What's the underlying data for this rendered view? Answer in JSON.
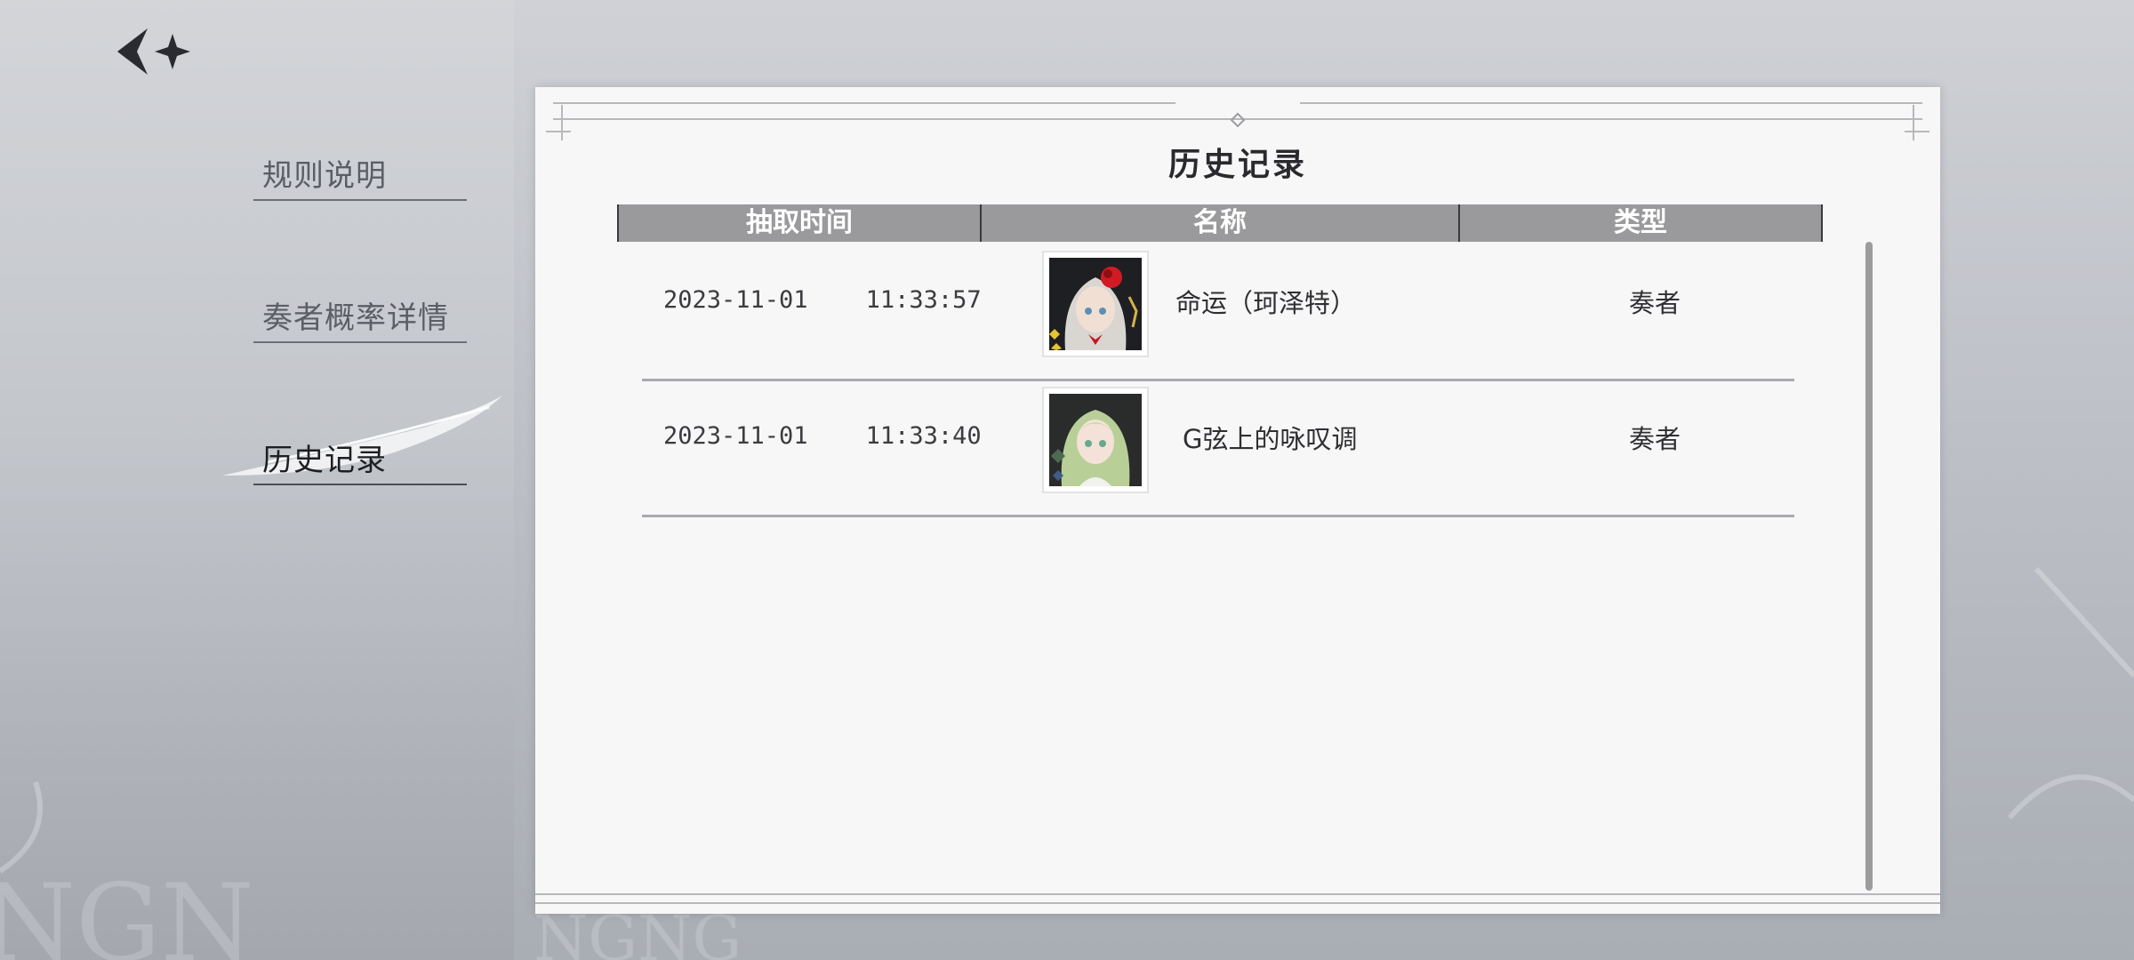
{
  "nav": {
    "back_icon": "back-arrow-sparkle-icon",
    "items": [
      {
        "label": "规则说明",
        "active": false
      },
      {
        "label": "奏者概率详情",
        "active": false
      },
      {
        "label": "历史记录",
        "active": true
      }
    ]
  },
  "panel": {
    "title": "历史记录",
    "columns": [
      "抽取时间",
      "名称",
      "类型"
    ],
    "rows": [
      {
        "date": "2023-11-01",
        "time": "11:33:57",
        "avatar_icon": "character-portrait-white-hair-red-rose-icon",
        "name": "命运（珂泽特）",
        "type": "奏者"
      },
      {
        "date": "2023-11-01",
        "time": "11:33:40",
        "avatar_icon": "character-portrait-green-hair-icon",
        "name": "G弦上的咏叹调",
        "type": "奏者"
      }
    ]
  },
  "colors": {
    "header_bg": "#9a9a9c",
    "panel_bg": "#f7f7f7",
    "active_text": "#1e1f23"
  }
}
